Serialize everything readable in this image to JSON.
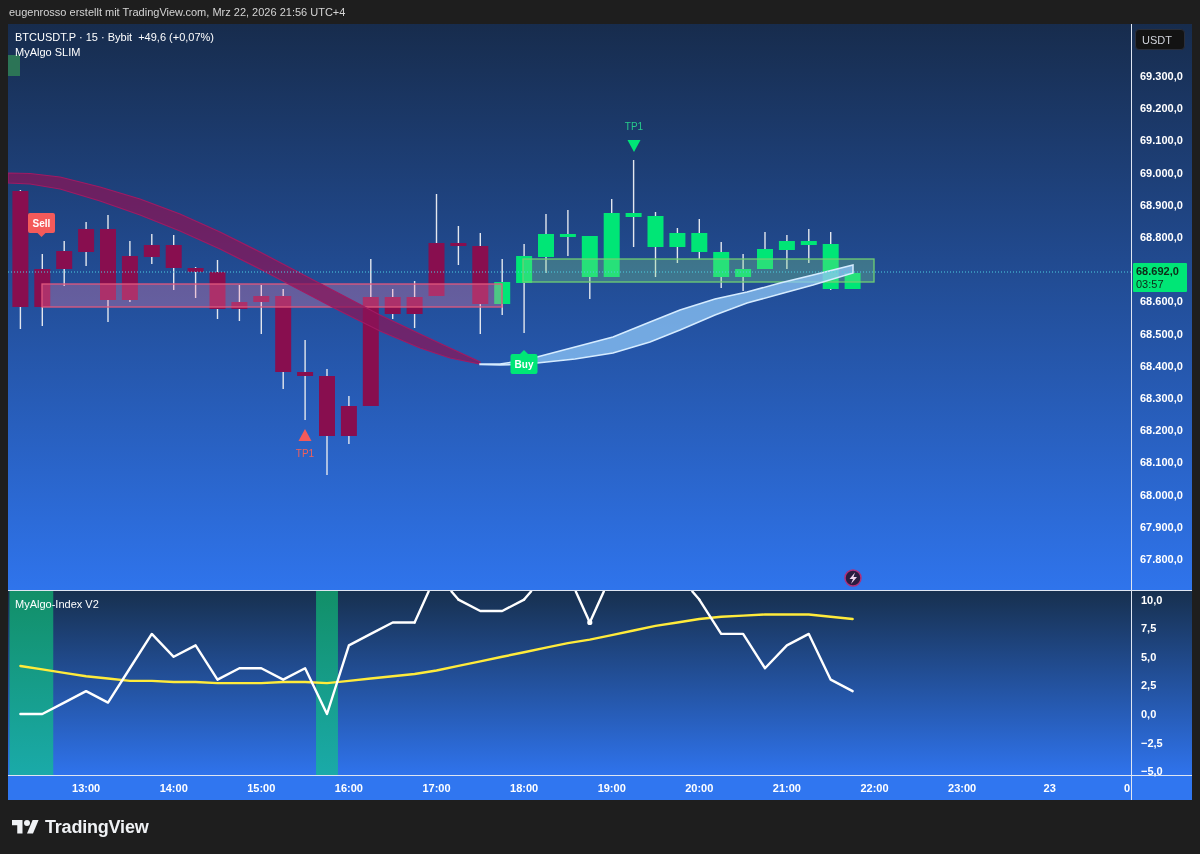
{
  "caption": "eugenrosso erstellt mit TradingView.com, Mrz 22, 2026 21:56 UTC+4",
  "main_pane": {
    "symbol": "BTCUSDT.P · 15 · Bybit",
    "change": "+49,6 (+0,07%)",
    "indicator": "MyAlgo SLIM",
    "signals": [
      {
        "kind": "target_high",
        "label": "TP1"
      },
      {
        "kind": "sell",
        "label": "Sell"
      },
      {
        "kind": "buy",
        "label": "Buy"
      },
      {
        "kind": "target_low",
        "label": "TP1"
      }
    ]
  },
  "price_axis": {
    "currency": "USDT",
    "ticks": [
      "69.300,0",
      "69.200,0",
      "69.100,0",
      "69.000,0",
      "68.900,0",
      "68.800,0",
      "68.600,0",
      "68.500,0",
      "68.400,0",
      "68.300,0",
      "68.200,0",
      "68.100,0",
      "68.000,0",
      "67.900,0",
      "67.800,0"
    ],
    "last_price": "68.692,0",
    "countdown": "03:57"
  },
  "indicator_pane": {
    "title": "MyAlgo-Index V2",
    "chart_data": {
      "type": "line",
      "categories": [
        null,
        null,
        null,
        "13:00",
        null,
        null,
        null,
        "14:00",
        null,
        null,
        null,
        "15:00",
        null,
        null,
        null,
        "16:00",
        null,
        null,
        null,
        "17:00",
        null,
        null,
        null,
        "18:00",
        null,
        null,
        null,
        "19:00",
        null,
        null,
        null,
        "20:00",
        null,
        null,
        null,
        "21:00",
        null,
        null,
        null,
        "22:00",
        null,
        null,
        null,
        "23:00",
        null,
        null,
        null,
        "23",
        null,
        null,
        null,
        "0"
      ],
      "series": [
        {
          "color": "#ffffff",
          "values": [
            0,
            0,
            1,
            2,
            1,
            4,
            7,
            5,
            6,
            3,
            4,
            4,
            3,
            4,
            0,
            6,
            7,
            8,
            8,
            null,
            10,
            9,
            9,
            10,
            null,
            null,
            8,
            null,
            null,
            null,
            null,
            10,
            7,
            7,
            4,
            6,
            7,
            3,
            2,
            null,
            null,
            null,
            null,
            null,
            null,
            null,
            null,
            null,
            null,
            null,
            null,
            null
          ]
        },
        {
          "color": "#ffeb3b",
          "values": [
            4.2,
            3.9,
            3.6,
            3.3,
            3.1,
            2.9,
            2.9,
            2.8,
            2.8,
            2.7,
            2.7,
            2.7,
            2.8,
            2.8,
            2.7,
            2.9,
            3.1,
            3.3,
            3.5,
            3.8,
            4.2,
            4.6,
            5.0,
            5.4,
            5.8,
            6.2,
            6.5,
            6.9,
            7.3,
            7.7,
            8.0,
            8.3,
            8.5,
            8.6,
            8.7,
            8.7,
            8.7,
            8.5,
            8.3,
            null,
            null,
            null,
            null,
            null,
            null,
            null,
            null,
            null,
            null,
            null,
            null,
            null
          ]
        }
      ],
      "ylim": [
        -5.33,
        10.75
      ],
      "yticks": [
        {
          "value": 10,
          "label": "10,0"
        },
        {
          "value": 7.5,
          "label": "7,5"
        },
        {
          "value": 5,
          "label": "5,0"
        },
        {
          "value": 2.5,
          "label": "2,5"
        },
        {
          "value": 0,
          "label": "0,0"
        },
        {
          "value": -2.5,
          "label": "−2,5"
        },
        {
          "value": -5,
          "label": "−5,0"
        }
      ]
    }
  },
  "footer": {
    "logo_text": "TradingView"
  }
}
